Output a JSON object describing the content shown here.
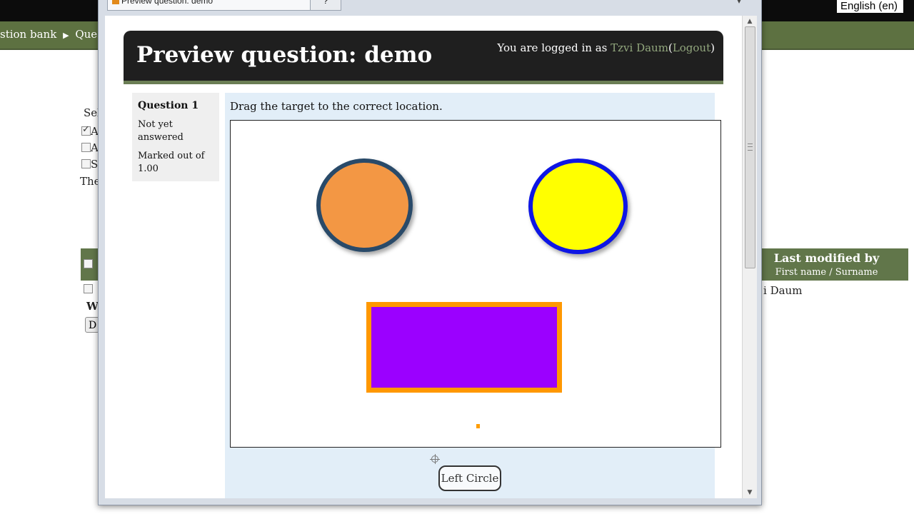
{
  "background": {
    "language": "English (en)",
    "breadcrumb": [
      "stion bank",
      "Quest"
    ],
    "breadcrumb_separator": "▶",
    "select_label": "Sel",
    "options": [
      {
        "label": "A",
        "checked": true
      },
      {
        "label": "A",
        "checked": false
      },
      {
        "label": "S",
        "checked": false
      }
    ],
    "partial_text": "The",
    "column_title": "Last modified by",
    "column_subtitle": "First name / Surname",
    "row_name": "i Daum",
    "with_selected": "W",
    "button_label": "D",
    "nav_color": "#5d7141"
  },
  "dialog": {
    "tab_title": "Preview question: demo",
    "tab2_label": "?",
    "close_glyph": "▾",
    "header": {
      "title": "Preview question: demo",
      "logged_in_prefix": "You are logged in as",
      "user_name": "Tzvi Daum",
      "logout_label": "Logout",
      "paren_open": "(",
      "paren_close": ")"
    },
    "question_info": {
      "number_label": "Question 1",
      "state": "Not yet answered",
      "grade": "Marked out of 1.00"
    },
    "question": {
      "text": "Drag the target to the correct location.",
      "drag_item": "Left Circle"
    },
    "shapes": [
      {
        "name": "left-circle",
        "fill": "#f39744",
        "stroke": "#294a69"
      },
      {
        "name": "right-circle",
        "fill": "#ffff00",
        "stroke": "#0e16e4"
      },
      {
        "name": "rectangle",
        "fill": "#9b00ff",
        "stroke": "#ff9800"
      }
    ],
    "scrollbar": {
      "up": "▲",
      "down": "▼"
    }
  }
}
